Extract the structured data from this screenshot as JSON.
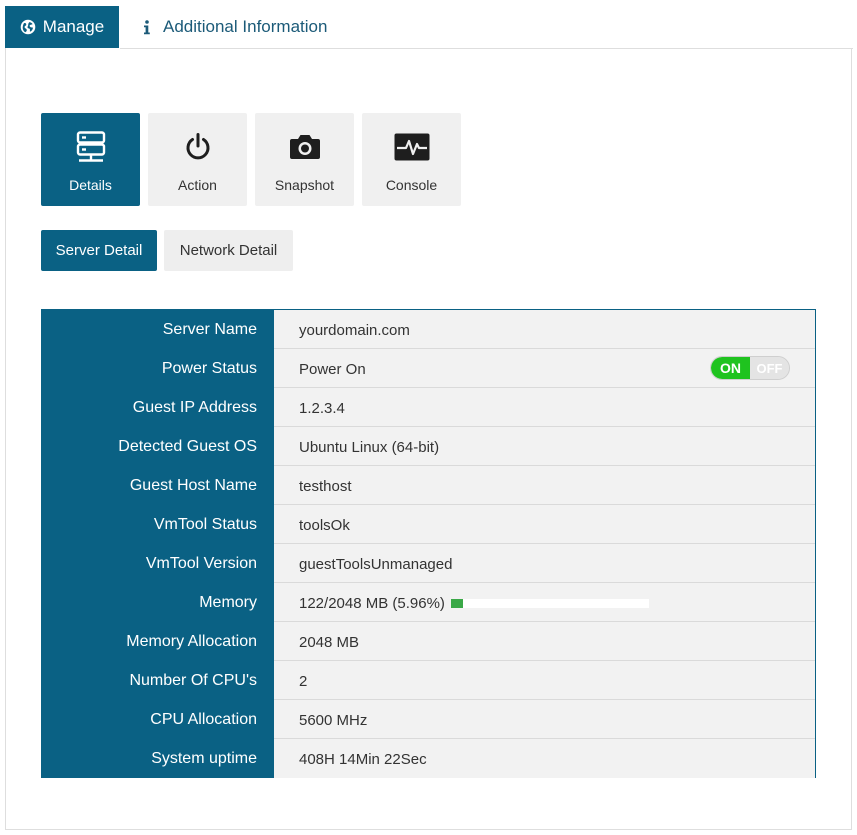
{
  "tabs": {
    "manage": "Manage",
    "info": "Additional Information"
  },
  "tiles": [
    {
      "label": "Details",
      "icon": "server-icon",
      "active": true
    },
    {
      "label": "Action",
      "icon": "power-icon",
      "active": false
    },
    {
      "label": "Snapshot",
      "icon": "camera-icon",
      "active": false
    },
    {
      "label": "Console",
      "icon": "console-icon",
      "active": false
    }
  ],
  "subtabs": {
    "server_detail": "Server Detail",
    "network_detail": "Network Detail"
  },
  "details": {
    "server_name": {
      "label": "Server Name",
      "value": "yourdomain.com"
    },
    "power_status": {
      "label": "Power Status",
      "value": "Power On"
    },
    "guest_ip": {
      "label": "Guest IP Address",
      "value": "1.2.3.4"
    },
    "guest_os": {
      "label": "Detected Guest OS",
      "value": "Ubuntu Linux (64-bit)"
    },
    "guest_host": {
      "label": "Guest Host Name",
      "value": "testhost"
    },
    "vmtool_status": {
      "label": "VmTool Status",
      "value": "toolsOk"
    },
    "vmtool_version": {
      "label": "VmTool Version",
      "value": "guestToolsUnmanaged"
    },
    "memory": {
      "label": "Memory",
      "value": "122/2048 MB (5.96%)",
      "usage_percent": 5.96
    },
    "memory_alloc": {
      "label": "Memory Allocation",
      "value": "2048 MB"
    },
    "cpu_count": {
      "label": "Number Of CPU's",
      "value": "2"
    },
    "cpu_alloc": {
      "label": "CPU Allocation",
      "value": "5600 MHz"
    },
    "uptime": {
      "label": "System uptime",
      "value": "408H 14Min 22Sec"
    }
  },
  "power_toggle": {
    "on": "ON",
    "off": "OFF",
    "state": "on"
  },
  "colors": {
    "brand": "#0a6184",
    "toggle_on": "#1fc31f",
    "memory_bar": "#3aa847"
  }
}
